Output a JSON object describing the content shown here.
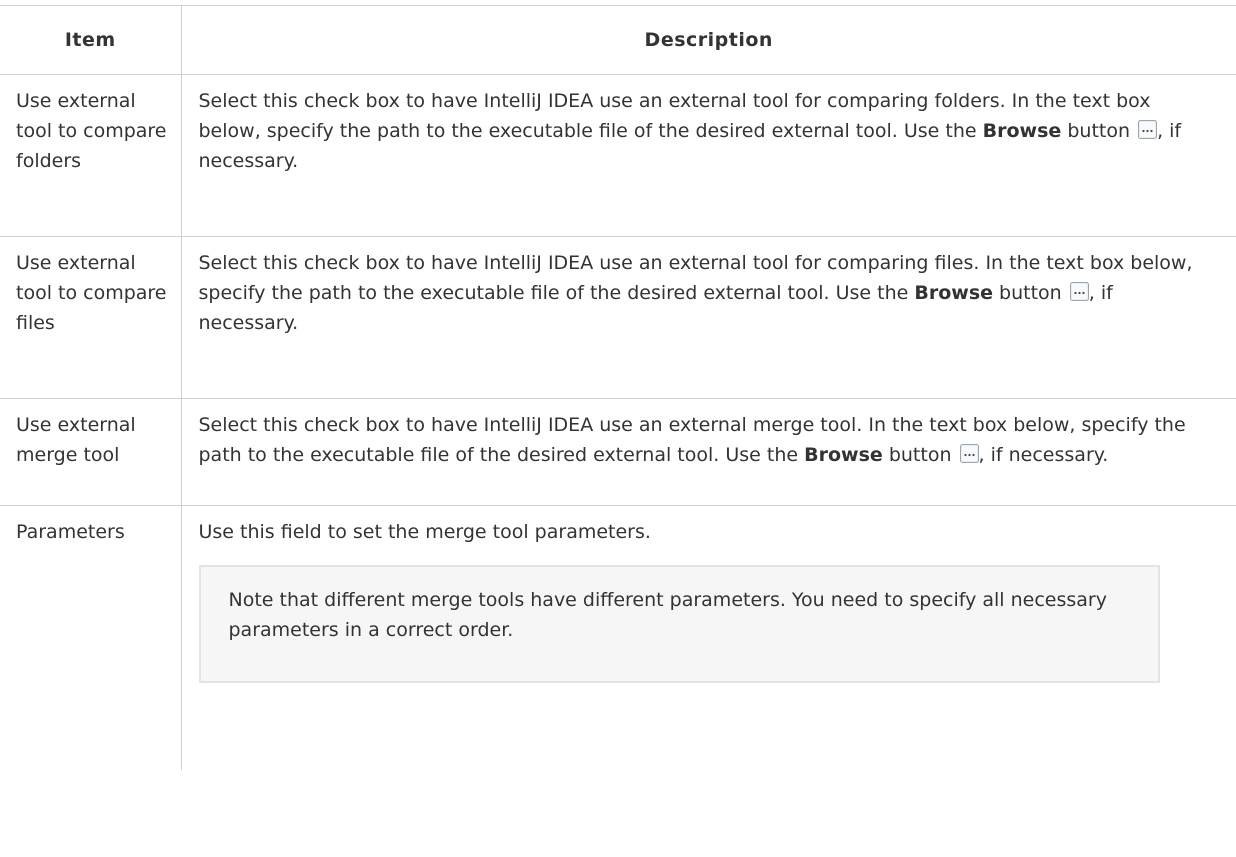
{
  "table": {
    "headers": {
      "item": "Item",
      "description": "Description"
    },
    "rows": [
      {
        "item": "Use external tool to compare folders",
        "desc_before": "Select this check box to have IntelliJ IDEA use an external tool for comparing folders. In the text box below, specify the path to the executable file of the desired external tool. Use the",
        "desc_bold": "Browse",
        "desc_mid": " button",
        "desc_after": ", if necessary."
      },
      {
        "item": "Use external tool to compare files",
        "desc_before": "Select this check box to have IntelliJ IDEA use an external tool for comparing files. In the text box below, specify the path to the executable file of the desired external tool. Use the",
        "desc_bold": "Browse",
        "desc_mid": " button",
        "desc_after": ", if necessary."
      },
      {
        "item": "Use external merge tool",
        "desc_before": "Select this check box to have IntelliJ IDEA use an external merge tool. In the text box below, specify the path to the executable file of the desired external tool. Use the",
        "desc_bold": "Browse",
        "desc_mid": " button",
        "desc_after": ", if necessary."
      },
      {
        "item": "Parameters",
        "desc": "Use this field to set the merge tool parameters.",
        "note": "Note that different merge tools have different parameters. You need to specify all necessary parameters in a correct order."
      }
    ]
  },
  "icons": {
    "browse": "browse-button-icon"
  },
  "colors": {
    "border": "#d0d0d0",
    "text": "#333333",
    "note_bg": "#f6f6f6",
    "note_border": "#e4e4e4"
  }
}
